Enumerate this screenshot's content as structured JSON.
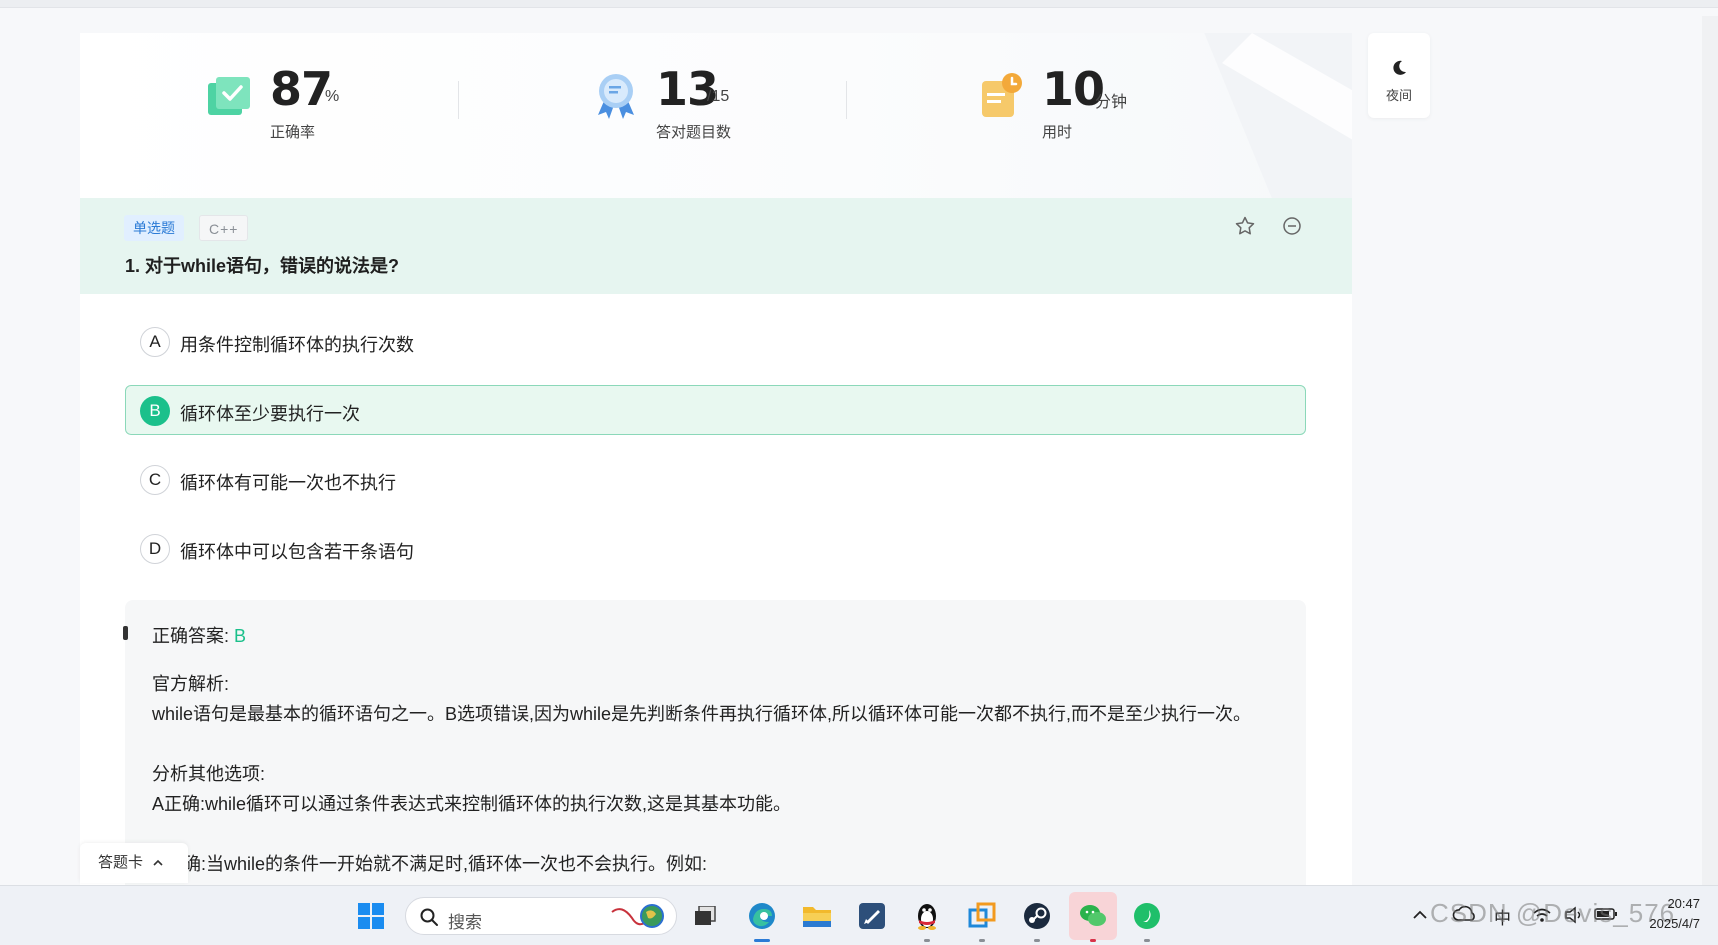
{
  "stats": {
    "accuracy_value": "87",
    "accuracy_unit": "%",
    "accuracy_label": "正确率",
    "correct_value": "13",
    "correct_total": "/15",
    "correct_label": "答对题目数",
    "time_value": "10",
    "time_unit": "分钟",
    "time_label": "用时"
  },
  "question": {
    "type_tag": "单选题",
    "lang_tag": "C++",
    "title": "1. 对于while语句，错误的说法是?",
    "options": [
      {
        "letter": "A",
        "text": "用条件控制循环体的执行次数",
        "selected": false
      },
      {
        "letter": "B",
        "text": "循环体至少要执行一次",
        "selected": true
      },
      {
        "letter": "C",
        "text": "循环体有可能一次也不执行",
        "selected": false
      },
      {
        "letter": "D",
        "text": "循环体中可以包含若干条语句",
        "selected": false
      }
    ]
  },
  "analysis": {
    "answer_label": "正确答案:",
    "answer_value": "B",
    "official_title": "官方解析:",
    "official_text": "while语句是最基本的循环语句之一。B选项错误,因为while是先判断条件再执行循环体,所以循环体可能一次都不执行,而不是至少执行一次。",
    "other_title": "分析其他选项:",
    "option_a_text": "A正确:while循环可以通过条件表达式来控制循环体的执行次数,这是其基本功能。",
    "option_c_text": "C正确:当while的条件一开始就不满足时,循环体一次也不会执行。例如:"
  },
  "answer_card": {
    "label": "答题卡"
  },
  "night_mode": {
    "label": "夜间"
  },
  "taskbar": {
    "search_placeholder": "搜索",
    "tray_ime": "中",
    "clock_time": "20:47",
    "clock_date": "2025/4/7",
    "watermark": "CSDN @Devis_576"
  },
  "colors": {
    "accent_green": "#1bc08b",
    "header_bg": "#e6f5f0",
    "tag_blue": "#2b7bd6"
  }
}
